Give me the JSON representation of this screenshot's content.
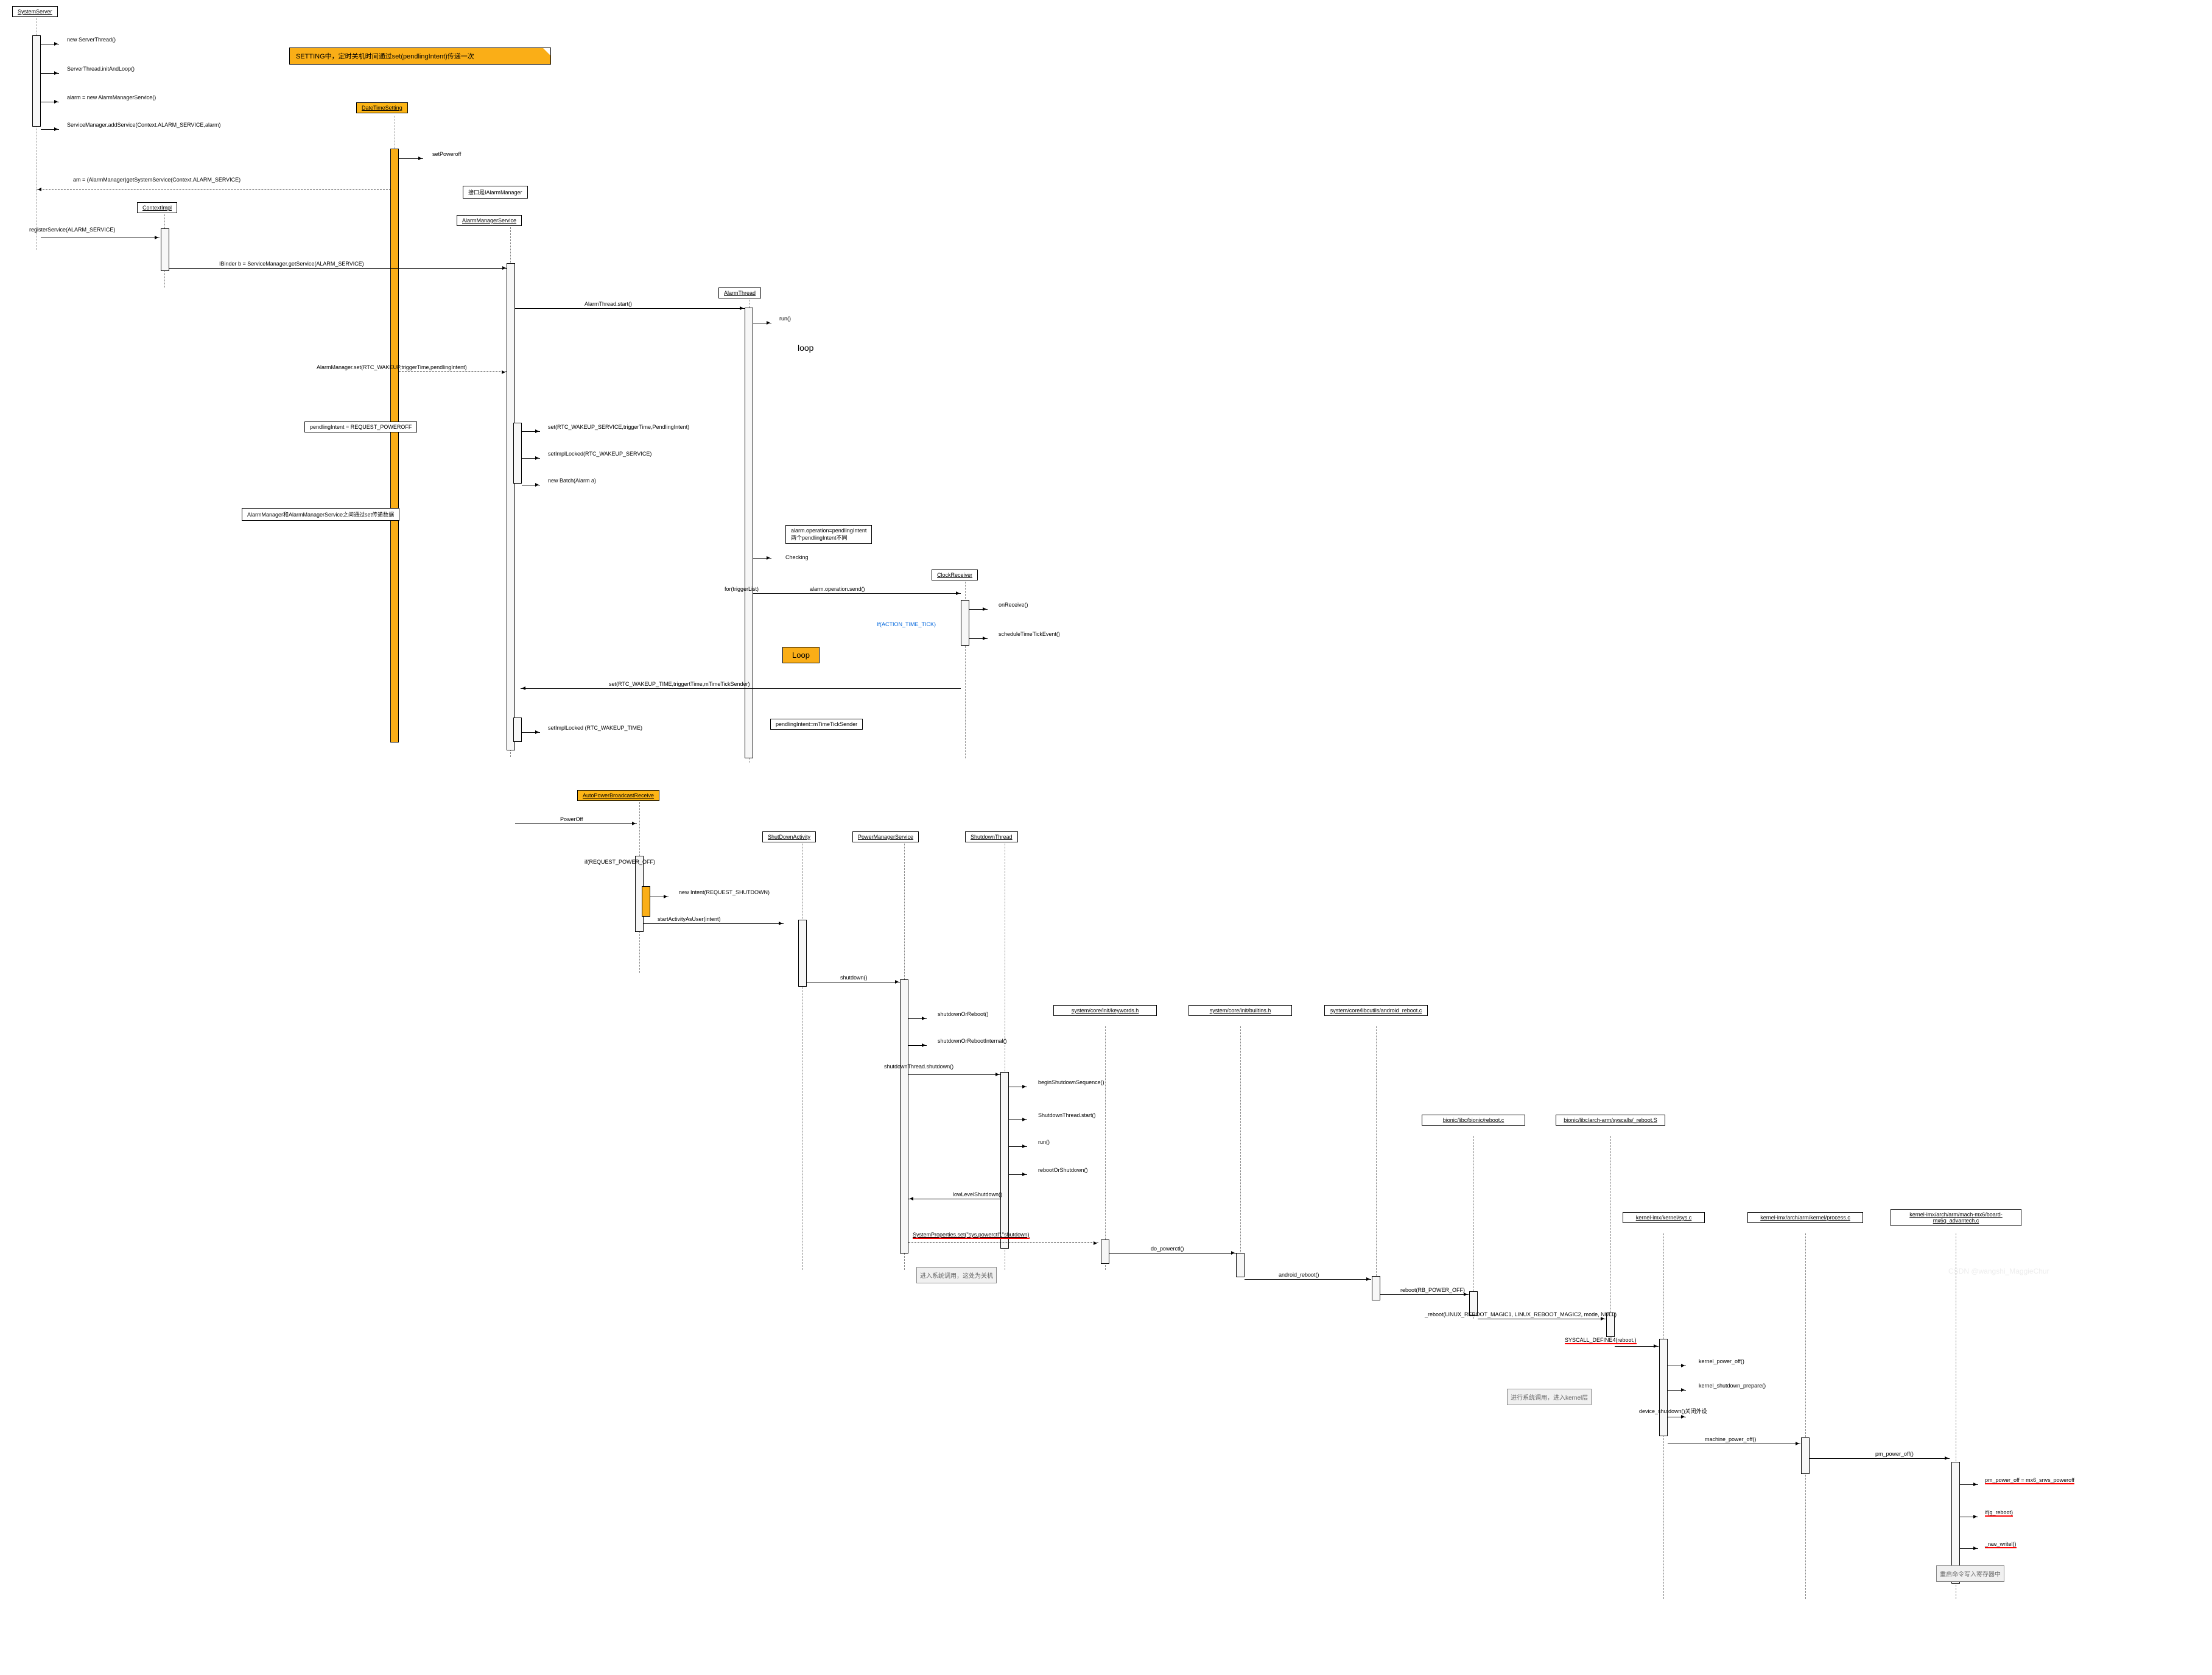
{
  "actors": {
    "system_server": "SystemServer",
    "context_impl": "ContextImpl",
    "date_time_setting": "DateTimeSetting",
    "alarm_manager_service": "AlarmManagerService",
    "ialarm_manager": "接口是IAlarmManager",
    "alarm_thread": "AlarmThread",
    "clock_receiver": "ClockReceiver",
    "auto_power_broadcast": "AutoPowerBroadcastReceive",
    "shutdown_activity": "ShutDownActivity",
    "power_manager_service": "PowerManagerService",
    "shutdown_thread": "ShutdownThread",
    "keywords_h": "system/core/init/keywords.h",
    "builtins_h": "system/core/init/builtins.h",
    "android_reboot_c": "system/core/libcutils/android_reboot.c",
    "bionic_reboot_c": "bionic/libc/bionic/reboot.c",
    "syscalls_reboot_s": "bionic/libc/arch-arm/syscalls/_reboot.S",
    "kernel_sys_c": "kernel-imx/kernel/sys.c",
    "kernel_process_c": "kernel-imx/arch/arm/kernel/process.c",
    "kernel_advantech_c": "kernel-imx/arch/arm/mach-mx6/board-mx6q_advantech.c"
  },
  "messages": {
    "new_server_thread": "new ServerThread()",
    "server_thread_init": "ServerThread.initAndLoop()",
    "alarm_new": "alarm = new AlarmManagerService()",
    "service_manager_add": "ServiceManager.addService(Context.ALARM_SERVICE,alarm)",
    "am_get_system_service": "am = (AlarmManager)getSystemService(Context.ALARM_SERVICE)",
    "register_service": "registerService(ALARM_SERVICE)",
    "ibinder_b": "IBinder b = ServiceManager.getService(ALARM_SERVICE)",
    "set_power_off": "setPoweroff",
    "alarm_manager_set": "AlarmManager.set(RTC_WAKEUP,triggerTime,pendlingIntent)",
    "pending_intent_request": "pendlingIntent = REQUEST_POWEROFF",
    "alarm_manager_note": "AlarmManager和AlarmManagerService之间通过set传递数据",
    "set_rtc_wakeup_service": "set(RTC_WAKEUP_SERVICE,triggerTime,PendlingIntent)",
    "set_impl_locked": "setImplLocked(RTC_WAKEUP_SERVICE)",
    "new_batch": "new Batch(Alarm a)",
    "alarm_thread_start": "AlarmThread.start()",
    "run": "run()",
    "loop": "loop",
    "alarm_operation_note": "alarm.operation=pendlingIntent\n两个pendlingIntent不同",
    "checking": "Checking",
    "for_trigger_list": "for(triggerList)",
    "alarm_operation_send": "alarm.operation.send()",
    "if_action_time_tick": "If(ACTION_TIME_TICK)",
    "on_receive": "onReceive()",
    "schedule_time_tick": "scheduleTimeTickEvent()",
    "loop_label": "Loop",
    "set_rtc_wakeup_time": "set(RTC_WAKEUP_TIME,triggertTime,mTimeTickSender)",
    "set_impl_locked_time": "setImplLocked (RTC_WAKEUP_TIME)",
    "pending_intent_time_tick": "pendlingIntent=mTimeTickSender",
    "power_off": "PowerOff",
    "if_request_power_off": "if(REQUEST_POWER_OFF)",
    "new_intent": "new Intent(REQUEST_SHUTDOWN)",
    "start_activity": "startActivityAsUser(intent)",
    "shutdown": "shutdown()",
    "shutdown_or_reboot": "shutdownOrReboot()",
    "shutdown_or_reboot_internal": "shutdownOrRebootInternal()",
    "shutdown_thread_shutdown": "shutdownThread.shutdown()",
    "begin_shutdown_sequence": "beginShutdownSequence()",
    "shutdown_thread_start": "ShutdownThread.start()",
    "run2": "run()",
    "reboot_or_shutdown": "rebootOrShutdown()",
    "low_level_shutdown": "lowLevelShutdown()",
    "system_properties_set": "SystemProperties.set(\"sys.powerctl\",\"shutdown)",
    "enter_system_note": "进入系统调用，这处为关机",
    "do_powerctl": "do_powerctl()",
    "android_reboot": "android_reboot()",
    "reboot_rb_power_off": "reboot(RB_POWER_OFF)",
    "reboot_linux_magic": "_reboot(LINUX_REBOOT_MAGIC1, LINUX_REBOOT_MAGIC2, mode, NULL)",
    "syscall_define4": "SYSCALL_DEFINE4(reboot,)",
    "enter_kernel_note": "进行系统调用，进入kernel层",
    "kernel_power_off": "kernel_power_off()",
    "kernel_shutdown_prepare": "kernel_shutdown_prepare()",
    "device_shutdown": "device_shutdown()关闭外设",
    "machine_power_off": "machine_power_off()",
    "pm_power_off": "pm_power_off()",
    "pm_power_off_mx6": "pm_power_off = mx6_snvs_poweroff",
    "if_g_reboot": "if(g_reboot)",
    "raw_writel": "_raw_writel()",
    "reboot_cmd_note": "重启命令写入寄存器中"
  },
  "notes": {
    "setting_note": "SETTING中，定时关机时间通过set(pendlingIntent)传递一次"
  }
}
